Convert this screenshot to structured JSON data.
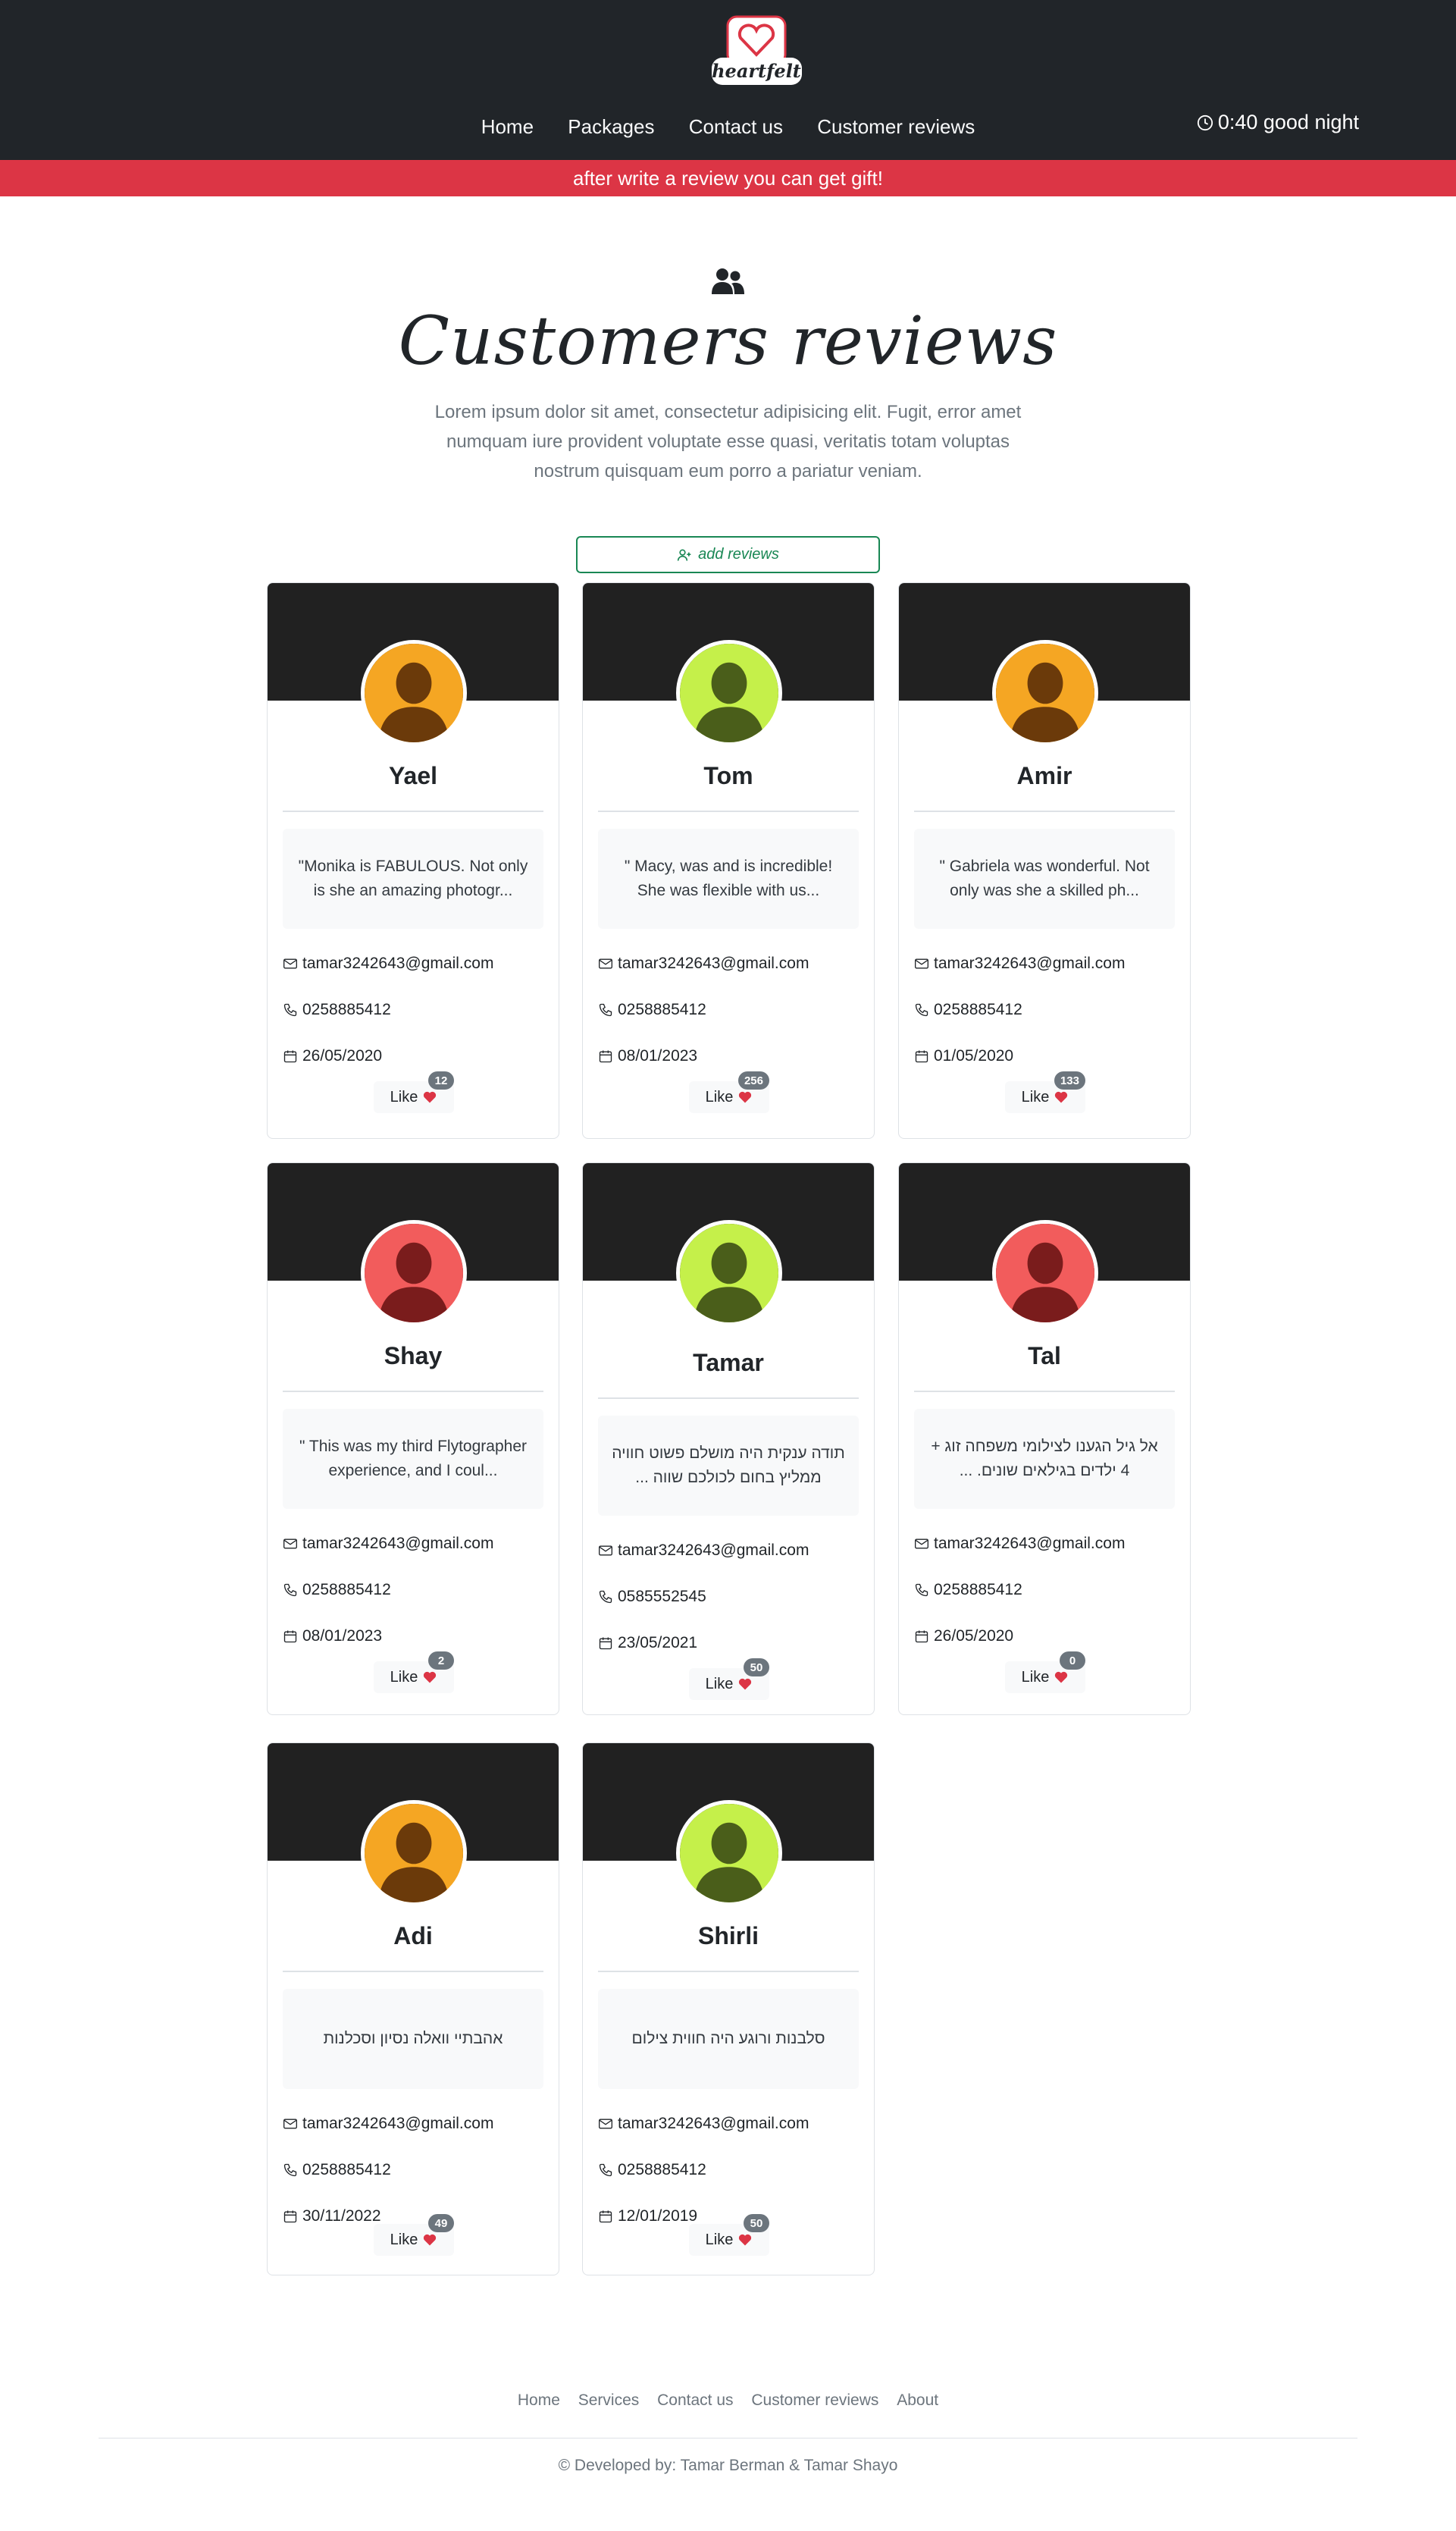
{
  "brand": {
    "logo_text": "heartfelt",
    "accent": "#dc3545",
    "dark": "#212529"
  },
  "nav": {
    "items": [
      "Home",
      "Packages",
      "Contact us",
      "Customer reviews"
    ]
  },
  "clock": {
    "text": "0:40 good night",
    "icon": "clock-icon"
  },
  "banner": {
    "text": "after write a review you can get gift!"
  },
  "hero": {
    "icon": "users-icon",
    "title": "Customers reviews",
    "text": "Lorem ipsum dolor sit amet, consectetur adipisicing elit. Fugit, error amet numquam iure provident voluptate esse quasi, veritatis totam voluptas nostrum quisquam eum porro a pariatur veniam."
  },
  "add_button": {
    "label": "add reviews",
    "icon": "user-plus-icon"
  },
  "like_label": "Like",
  "reviews": [
    {
      "name": "Yael",
      "quote": "\"Monika is FABULOUS. Not only is she an amazing photogr...",
      "email": "tamar3242643@gmail.com",
      "phone": "0258885412",
      "date": "26/05/2020",
      "likes": "12",
      "avatar_color": "#f5a623",
      "avatar_shade": "#6b3a0a"
    },
    {
      "name": "Tom",
      "quote": "\" Macy, was and is incredible! She was flexible with us...",
      "email": "tamar3242643@gmail.com",
      "phone": "0258885412",
      "date": "08/01/2023",
      "likes": "256",
      "avatar_color": "#c5f04a",
      "avatar_shade": "#4a5e1a"
    },
    {
      "name": "Amir",
      "quote": "\" Gabriela was wonderful. Not only was she a skilled ph...",
      "email": "tamar3242643@gmail.com",
      "phone": "0258885412",
      "date": "01/05/2020",
      "likes": "133",
      "avatar_color": "#f5a623",
      "avatar_shade": "#6b3a0a"
    },
    {
      "name": "Shay",
      "quote": "\" This was my third Flytographer experience, and I coul...",
      "email": "tamar3242643@gmail.com",
      "phone": "0258885412",
      "date": "08/01/2023",
      "likes": "2",
      "avatar_color": "#f25c5c",
      "avatar_shade": "#7a1c1c"
    },
    {
      "name": "Tamar",
      "quote": "תודה ענקית היה מושלם פשוט חוויה ממליץ בחום לכולכם שווה ...",
      "email": "tamar3242643@gmail.com",
      "phone": "0585552545",
      "date": "23/05/2021",
      "likes": "50",
      "avatar_color": "#c5f04a",
      "avatar_shade": "#4a5e1a"
    },
    {
      "name": "Tal",
      "quote": "אל גיל הגענו לצילומי משפחה זוג + 4 ילדים בגילאים שונים. ...",
      "email": "tamar3242643@gmail.com",
      "phone": "0258885412",
      "date": "26/05/2020",
      "likes": "0",
      "avatar_color": "#f25c5c",
      "avatar_shade": "#7a1c1c"
    },
    {
      "name": "Adi",
      "quote": "אהבתיי וואלה נסיון וסכלנות",
      "email": "tamar3242643@gmail.com",
      "phone": "0258885412",
      "date": "30/11/2022",
      "likes": "49",
      "avatar_color": "#f5a623",
      "avatar_shade": "#6b3a0a"
    },
    {
      "name": "Shirli",
      "quote": "סלבנות ורוגע היה חווית צילום",
      "email": "tamar3242643@gmail.com",
      "phone": "0258885412",
      "date": "12/01/2019",
      "likes": "50",
      "avatar_color": "#c5f04a",
      "avatar_shade": "#4a5e1a"
    }
  ],
  "footer": {
    "links": [
      "Home",
      "Services",
      "Contact us",
      "Customer reviews",
      "About"
    ],
    "copyright": "© Developed by: Tamar Berman & Tamar Shayo"
  }
}
